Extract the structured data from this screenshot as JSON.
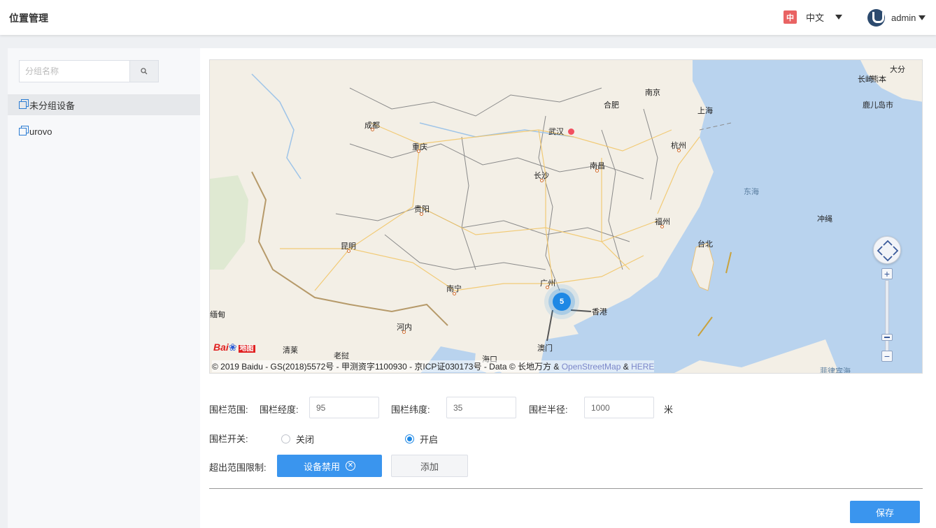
{
  "header": {
    "title": "位置管理",
    "lang_badge": "中",
    "lang_label": "中文",
    "user_name": "admin"
  },
  "sidebar": {
    "search_placeholder": "分组名称",
    "items": [
      {
        "label": "未分组设备",
        "active": true
      },
      {
        "label": "urovo",
        "active": false
      }
    ]
  },
  "map": {
    "cities": [
      "南京",
      "合肥",
      "上海",
      "成都",
      "武汉",
      "杭州",
      "重庆",
      "长沙",
      "南昌",
      "贵阳",
      "福州",
      "昆明",
      "台北",
      "广州",
      "南宁",
      "香港",
      "澳门",
      "缅甸",
      "河内",
      "海口",
      "清莱",
      "老挝",
      "长崎",
      "熊本",
      "大分",
      "鹿儿岛市",
      "冲绳",
      "东海",
      "菲律宾海"
    ],
    "cluster_count": "5",
    "cluster_label_partial": "澳门 香港",
    "copyright_text": "© 2019 Baidu - GS(2018)5572号 - 甲测资字1100930 - 京ICP证030173号 - Data © 长地万方 & ",
    "copyright_link1": "OpenStreetMap",
    "copyright_amp": " & ",
    "copyright_link2": "HERE",
    "logo_text": "Bai",
    "logo_di": "地图",
    "zoom_in": "+",
    "zoom_out": "−"
  },
  "form": {
    "range_label": "围栏范围:",
    "lng_label": "围栏经度:",
    "lng_value": "95",
    "lat_label": "围栏纬度:",
    "lat_value": "35",
    "radius_label": "围栏半径:",
    "radius_value": "1000",
    "radius_unit": "米",
    "switch_label": "围栏开关:",
    "switch_off": "关闭",
    "switch_on": "开启",
    "switch_selected": "开启",
    "limit_label": "超出范围限制:",
    "disable_button": "设备禁用",
    "add_button": "添加",
    "save_button": "保存"
  },
  "colors": {
    "primary": "#3a95ee",
    "lang_badge": "#e96363",
    "sea": "#b9d3ee",
    "land": "#f3efe6"
  }
}
